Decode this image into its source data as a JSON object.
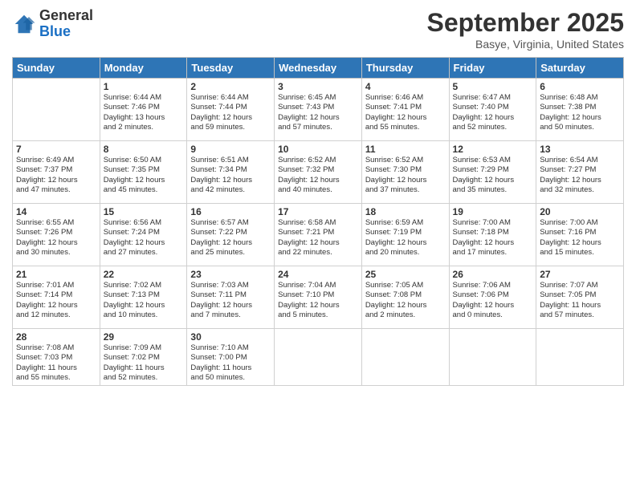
{
  "header": {
    "logo_general": "General",
    "logo_blue": "Blue",
    "month": "September 2025",
    "location": "Basye, Virginia, United States"
  },
  "weekdays": [
    "Sunday",
    "Monday",
    "Tuesday",
    "Wednesday",
    "Thursday",
    "Friday",
    "Saturday"
  ],
  "weeks": [
    [
      {
        "day": "",
        "text": ""
      },
      {
        "day": "1",
        "text": "Sunrise: 6:44 AM\nSunset: 7:46 PM\nDaylight: 13 hours\nand 2 minutes."
      },
      {
        "day": "2",
        "text": "Sunrise: 6:44 AM\nSunset: 7:44 PM\nDaylight: 12 hours\nand 59 minutes."
      },
      {
        "day": "3",
        "text": "Sunrise: 6:45 AM\nSunset: 7:43 PM\nDaylight: 12 hours\nand 57 minutes."
      },
      {
        "day": "4",
        "text": "Sunrise: 6:46 AM\nSunset: 7:41 PM\nDaylight: 12 hours\nand 55 minutes."
      },
      {
        "day": "5",
        "text": "Sunrise: 6:47 AM\nSunset: 7:40 PM\nDaylight: 12 hours\nand 52 minutes."
      },
      {
        "day": "6",
        "text": "Sunrise: 6:48 AM\nSunset: 7:38 PM\nDaylight: 12 hours\nand 50 minutes."
      }
    ],
    [
      {
        "day": "7",
        "text": "Sunrise: 6:49 AM\nSunset: 7:37 PM\nDaylight: 12 hours\nand 47 minutes."
      },
      {
        "day": "8",
        "text": "Sunrise: 6:50 AM\nSunset: 7:35 PM\nDaylight: 12 hours\nand 45 minutes."
      },
      {
        "day": "9",
        "text": "Sunrise: 6:51 AM\nSunset: 7:34 PM\nDaylight: 12 hours\nand 42 minutes."
      },
      {
        "day": "10",
        "text": "Sunrise: 6:52 AM\nSunset: 7:32 PM\nDaylight: 12 hours\nand 40 minutes."
      },
      {
        "day": "11",
        "text": "Sunrise: 6:52 AM\nSunset: 7:30 PM\nDaylight: 12 hours\nand 37 minutes."
      },
      {
        "day": "12",
        "text": "Sunrise: 6:53 AM\nSunset: 7:29 PM\nDaylight: 12 hours\nand 35 minutes."
      },
      {
        "day": "13",
        "text": "Sunrise: 6:54 AM\nSunset: 7:27 PM\nDaylight: 12 hours\nand 32 minutes."
      }
    ],
    [
      {
        "day": "14",
        "text": "Sunrise: 6:55 AM\nSunset: 7:26 PM\nDaylight: 12 hours\nand 30 minutes."
      },
      {
        "day": "15",
        "text": "Sunrise: 6:56 AM\nSunset: 7:24 PM\nDaylight: 12 hours\nand 27 minutes."
      },
      {
        "day": "16",
        "text": "Sunrise: 6:57 AM\nSunset: 7:22 PM\nDaylight: 12 hours\nand 25 minutes."
      },
      {
        "day": "17",
        "text": "Sunrise: 6:58 AM\nSunset: 7:21 PM\nDaylight: 12 hours\nand 22 minutes."
      },
      {
        "day": "18",
        "text": "Sunrise: 6:59 AM\nSunset: 7:19 PM\nDaylight: 12 hours\nand 20 minutes."
      },
      {
        "day": "19",
        "text": "Sunrise: 7:00 AM\nSunset: 7:18 PM\nDaylight: 12 hours\nand 17 minutes."
      },
      {
        "day": "20",
        "text": "Sunrise: 7:00 AM\nSunset: 7:16 PM\nDaylight: 12 hours\nand 15 minutes."
      }
    ],
    [
      {
        "day": "21",
        "text": "Sunrise: 7:01 AM\nSunset: 7:14 PM\nDaylight: 12 hours\nand 12 minutes."
      },
      {
        "day": "22",
        "text": "Sunrise: 7:02 AM\nSunset: 7:13 PM\nDaylight: 12 hours\nand 10 minutes."
      },
      {
        "day": "23",
        "text": "Sunrise: 7:03 AM\nSunset: 7:11 PM\nDaylight: 12 hours\nand 7 minutes."
      },
      {
        "day": "24",
        "text": "Sunrise: 7:04 AM\nSunset: 7:10 PM\nDaylight: 12 hours\nand 5 minutes."
      },
      {
        "day": "25",
        "text": "Sunrise: 7:05 AM\nSunset: 7:08 PM\nDaylight: 12 hours\nand 2 minutes."
      },
      {
        "day": "26",
        "text": "Sunrise: 7:06 AM\nSunset: 7:06 PM\nDaylight: 12 hours\nand 0 minutes."
      },
      {
        "day": "27",
        "text": "Sunrise: 7:07 AM\nSunset: 7:05 PM\nDaylight: 11 hours\nand 57 minutes."
      }
    ],
    [
      {
        "day": "28",
        "text": "Sunrise: 7:08 AM\nSunset: 7:03 PM\nDaylight: 11 hours\nand 55 minutes."
      },
      {
        "day": "29",
        "text": "Sunrise: 7:09 AM\nSunset: 7:02 PM\nDaylight: 11 hours\nand 52 minutes."
      },
      {
        "day": "30",
        "text": "Sunrise: 7:10 AM\nSunset: 7:00 PM\nDaylight: 11 hours\nand 50 minutes."
      },
      {
        "day": "",
        "text": ""
      },
      {
        "day": "",
        "text": ""
      },
      {
        "day": "",
        "text": ""
      },
      {
        "day": "",
        "text": ""
      }
    ]
  ]
}
